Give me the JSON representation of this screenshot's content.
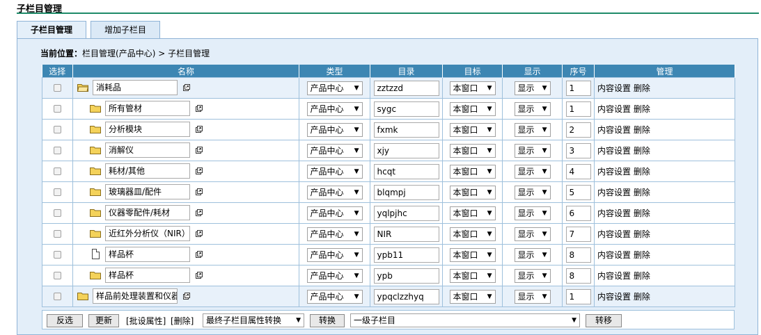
{
  "page_title": "子栏目管理",
  "tabs": [
    {
      "label": "子栏目管理"
    },
    {
      "label": "增加子栏目"
    }
  ],
  "breadcrumb": {
    "label": "当前位置：",
    "path": "栏目管理(产品中心) > 子栏目管理"
  },
  "columns": [
    "选择",
    "名称",
    "类型",
    "目录",
    "目标",
    "显示",
    "序号",
    "管理"
  ],
  "rows": [
    {
      "name": "消耗品",
      "icon": "folder-open-icon",
      "level": 0,
      "type": "产品中心",
      "dir": "zztzzd",
      "target": "本窗口",
      "show": "显示",
      "order": "1",
      "manage_content": "内容设置",
      "manage_delete": "删除"
    },
    {
      "name": "所有管材",
      "icon": "folder-icon",
      "level": 1,
      "type": "产品中心",
      "dir": "sygc",
      "target": "本窗口",
      "show": "显示",
      "order": "1",
      "manage_content": "内容设置",
      "manage_delete": "删除"
    },
    {
      "name": "分析模块",
      "icon": "folder-icon",
      "level": 1,
      "type": "产品中心",
      "dir": "fxmk",
      "target": "本窗口",
      "show": "显示",
      "order": "2",
      "manage_content": "内容设置",
      "manage_delete": "删除"
    },
    {
      "name": "消解仪",
      "icon": "folder-icon",
      "level": 1,
      "type": "产品中心",
      "dir": "xjy",
      "target": "本窗口",
      "show": "显示",
      "order": "3",
      "manage_content": "内容设置",
      "manage_delete": "删除"
    },
    {
      "name": "耗材/其他",
      "icon": "folder-icon",
      "level": 1,
      "type": "产品中心",
      "dir": "hcqt",
      "target": "本窗口",
      "show": "显示",
      "order": "4",
      "manage_content": "内容设置",
      "manage_delete": "删除"
    },
    {
      "name": "玻璃器皿/配件",
      "icon": "folder-icon",
      "level": 1,
      "type": "产品中心",
      "dir": "blqmpj",
      "target": "本窗口",
      "show": "显示",
      "order": "5",
      "manage_content": "内容设置",
      "manage_delete": "删除"
    },
    {
      "name": "仪器零配件/耗材",
      "icon": "folder-icon",
      "level": 1,
      "type": "产品中心",
      "dir": "yqlpjhc",
      "target": "本窗口",
      "show": "显示",
      "order": "6",
      "manage_content": "内容设置",
      "manage_delete": "删除"
    },
    {
      "name": "近红外分析仪（NIR）",
      "icon": "folder-icon",
      "level": 1,
      "type": "产品中心",
      "dir": "NIR",
      "target": "本窗口",
      "show": "显示",
      "order": "7",
      "manage_content": "内容设置",
      "manage_delete": "删除"
    },
    {
      "name": "样品杯",
      "icon": "document-icon",
      "level": 1,
      "type": "产品中心",
      "dir": "ypb11",
      "target": "本窗口",
      "show": "显示",
      "order": "8",
      "manage_content": "内容设置",
      "manage_delete": "删除"
    },
    {
      "name": "样品杯",
      "icon": "folder-icon",
      "level": 1,
      "type": "产品中心",
      "dir": "ypb",
      "target": "本窗口",
      "show": "显示",
      "order": "8",
      "manage_content": "内容设置",
      "manage_delete": "删除"
    },
    {
      "name": "样品前处理装置和仪器",
      "icon": "folder-icon",
      "level": 0,
      "type": "产品中心",
      "dir": "ypqclzzhyq",
      "target": "本窗口",
      "show": "显示",
      "order": "1",
      "manage_content": "内容设置",
      "manage_delete": "删除"
    }
  ],
  "footer": {
    "invert_label": "反选",
    "update_label": "更新",
    "batch_label": "[批设属性]",
    "delete_label": "[删除]",
    "convert_select": "最终子栏目属性转换",
    "convert_button": "转换",
    "move_select": "一级子栏目",
    "move_button": "转移"
  },
  "colors": {
    "header_bg": "#3d86b3",
    "panel_bg": "#e3eef9",
    "title_line": "#1e8a68",
    "folder": "#f4d25a"
  }
}
